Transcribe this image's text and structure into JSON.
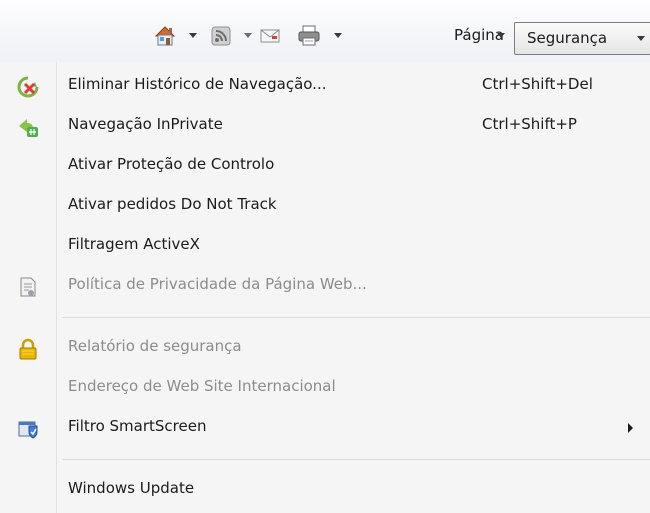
{
  "commandbar": {
    "home_icon": "home-icon",
    "feeds_icon": "rss-feed-icon",
    "mail_icon": "mail-icon",
    "print_icon": "printer-icon",
    "pagina_label": "Página",
    "seguranca_label": "Segurança"
  },
  "menu": {
    "items": [
      {
        "label": "Eliminar Histórico de Navegação...",
        "shortcut": "Ctrl+Shift+Del",
        "icon": "delete-history-icon",
        "enabled": true
      },
      {
        "label": "Navegação InPrivate",
        "shortcut": "Ctrl+Shift+P",
        "icon": "inprivate-icon",
        "enabled": true
      },
      {
        "label": "Ativar Proteção de Controlo",
        "enabled": true
      },
      {
        "label": "Ativar pedidos Do Not Track",
        "enabled": true
      },
      {
        "label": "Filtragem ActiveX",
        "enabled": true
      },
      {
        "label": "Política de Privacidade da Página Web...",
        "icon": "privacy-policy-icon",
        "enabled": false
      },
      {
        "label": "Relatório de segurança",
        "icon": "padlock-icon",
        "enabled": false
      },
      {
        "label": "Endereço de Web Site Internacional",
        "enabled": false
      },
      {
        "label": "Filtro SmartScreen",
        "icon": "smartscreen-filter-icon",
        "submenu": true,
        "enabled": true
      },
      {
        "label": "Windows Update",
        "enabled": true
      }
    ]
  }
}
